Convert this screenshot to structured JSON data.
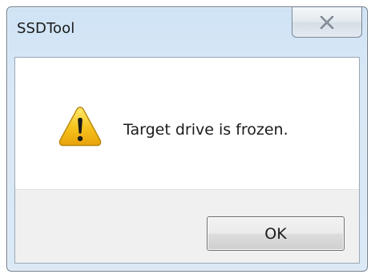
{
  "window": {
    "title": "SSDTool",
    "close_icon": "close-x-icon"
  },
  "message": {
    "icon": "warning-icon",
    "text": "Target drive is frozen."
  },
  "buttons": {
    "ok_label": "OK"
  },
  "colors": {
    "frame_tint": "#d9e8f6",
    "client_background": "#ffffff",
    "button_strip": "#f0f0f0",
    "warning_yellow": "#f6c21b"
  }
}
